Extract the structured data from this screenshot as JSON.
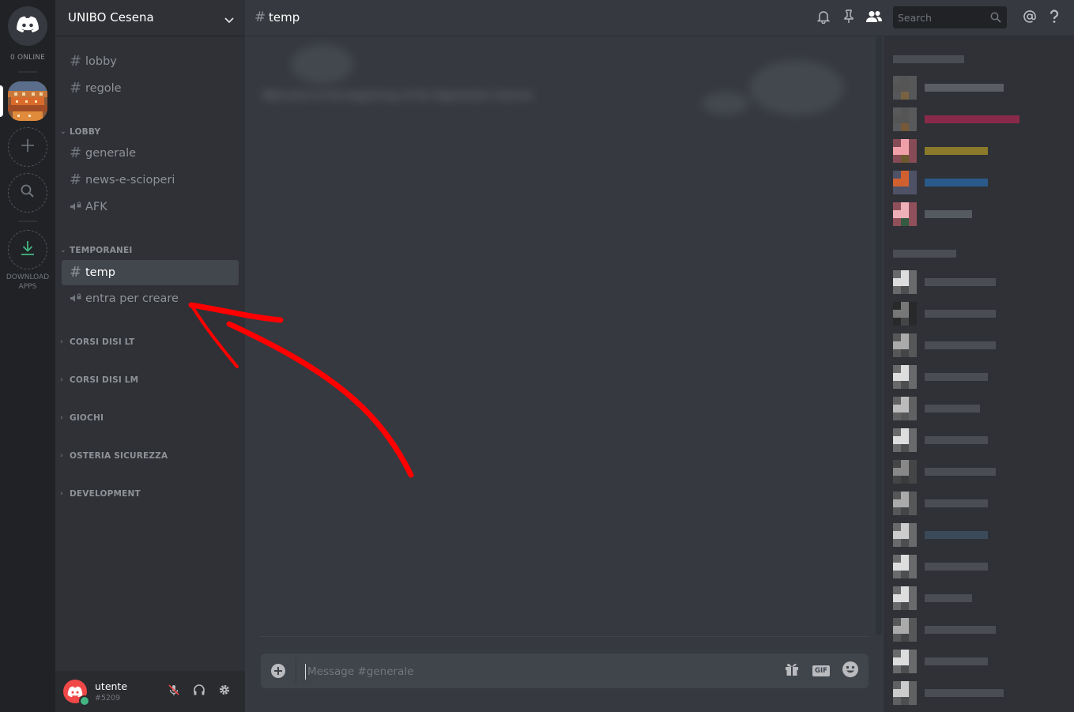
{
  "rail": {
    "online_label": "0 ONLINE",
    "download_label": "DOWNLOAD APPS"
  },
  "guild": {
    "name": "UNIBO Cesena"
  },
  "channels": {
    "top": [
      {
        "type": "text",
        "name": "lobby"
      },
      {
        "type": "text",
        "name": "regole"
      }
    ],
    "categories": [
      {
        "name": "LOBBY",
        "items": [
          {
            "type": "text",
            "name": "generale"
          },
          {
            "type": "text",
            "name": "news-e-scioperi"
          },
          {
            "type": "voice",
            "name": "AFK"
          }
        ]
      },
      {
        "name": "TEMPORANEI",
        "items": [
          {
            "type": "text",
            "name": "temp",
            "active": true
          },
          {
            "type": "voice",
            "name": "entra per creare"
          }
        ]
      },
      {
        "name": "CORSI DISI LT",
        "items": []
      },
      {
        "name": "CORSI DISI LM",
        "items": []
      },
      {
        "name": "GIOCHI",
        "items": []
      },
      {
        "name": "OSTERIA SICUREZZA",
        "items": []
      },
      {
        "name": "DEVELOPMENT",
        "items": []
      }
    ]
  },
  "user": {
    "name": "utente",
    "tag": "#5209",
    "status_color": "#43b581"
  },
  "topbar": {
    "hash": "#",
    "channel": "temp",
    "search_placeholder": "Search"
  },
  "composer": {
    "placeholder": "Message #generale",
    "gif_label": "GIF"
  },
  "colors": {
    "accent": "#7289da",
    "annotation_arrow": "#ff0000",
    "download_green": "#43b581"
  }
}
